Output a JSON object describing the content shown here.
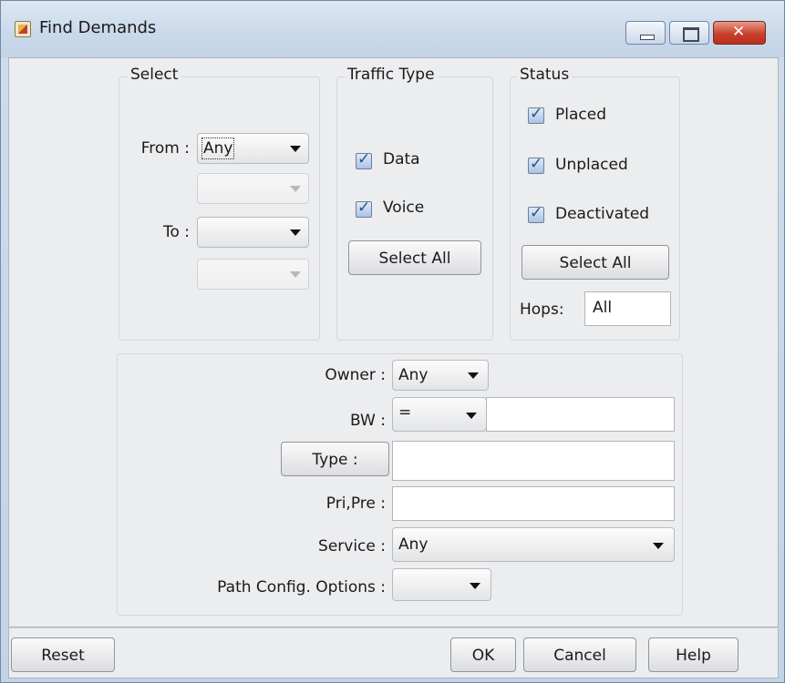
{
  "window": {
    "title": "Find Demands"
  },
  "select_group": {
    "title": "Select",
    "from_label": "From :",
    "from_value": "Any",
    "to_label": "To :",
    "to_value": ""
  },
  "traffic_group": {
    "title": "Traffic Type",
    "items": [
      {
        "label": "Data",
        "checked": true
      },
      {
        "label": "Voice",
        "checked": true
      }
    ],
    "select_all": "Select All"
  },
  "status_group": {
    "title": "Status",
    "items": [
      {
        "label": "Placed",
        "checked": true
      },
      {
        "label": "Unplaced",
        "checked": true
      },
      {
        "label": "Deactivated",
        "checked": true
      }
    ],
    "select_all": "Select All",
    "hops_label": "Hops:",
    "hops_value": "All"
  },
  "filters": {
    "owner_label": "Owner :",
    "owner_value": "Any",
    "bw_label": "BW :",
    "bw_operator": "=",
    "bw_value": "",
    "type_button": "Type :",
    "type_value": "",
    "pripre_label": "Pri,Pre :",
    "pripre_value": "",
    "service_label": "Service :",
    "service_value": "Any",
    "path_label": "Path Config. Options :",
    "path_value": ""
  },
  "footer": {
    "reset": "Reset",
    "ok": "OK",
    "cancel": "Cancel",
    "help": "Help"
  },
  "icons": [
    "app-icon",
    "minimize-icon",
    "maximize-icon",
    "close-icon",
    "chevron-down-icon",
    "checkmark-icon"
  ]
}
